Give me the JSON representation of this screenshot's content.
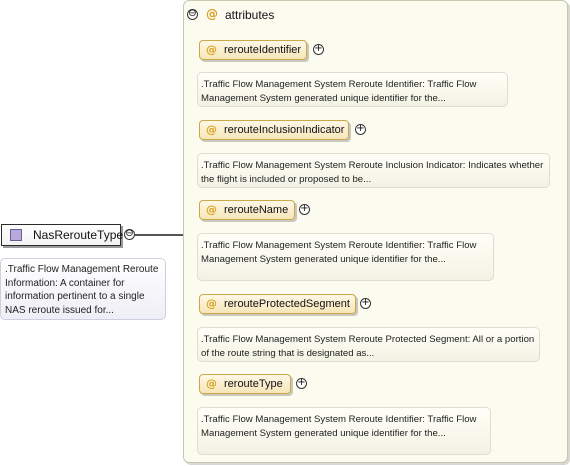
{
  "element": {
    "name": "NasRerouteType",
    "icon": "complex-type-icon",
    "expander": "⊖",
    "documentation": ".Traffic Flow Management Reroute Information: A container for information pertinent to a single NAS reroute issued for..."
  },
  "attributes_group": {
    "title": "attributes",
    "expander": "⊖",
    "at_symbol": "@",
    "items": [
      {
        "name": "rerouteIdentifier",
        "expander": "+",
        "documentation": ".Traffic Flow Management System Reroute Identifier: Traffic Flow Management System generated unique identifier for the..."
      },
      {
        "name": "rerouteInclusionIndicator",
        "expander": "+",
        "documentation": ".Traffic Flow Management System Reroute Inclusion Indicator: Indicates whether the flight is included or proposed to be..."
      },
      {
        "name": "rerouteName",
        "expander": "+",
        "documentation": ".Traffic Flow Management System Reroute Identifier: Traffic Flow Management System generated unique identifier for the..."
      },
      {
        "name": "rerouteProtectedSegment",
        "expander": "+",
        "documentation": ".Traffic Flow Management System Reroute Protected Segment: All or a portion of the route string that is designated as..."
      },
      {
        "name": "rerouteType",
        "expander": "+",
        "documentation": ".Traffic Flow Management System Reroute Identifier: Traffic Flow Management System generated unique identifier for the..."
      }
    ]
  },
  "colors": {
    "attribute_fill": "#f6e6b8",
    "attribute_border": "#c9a848",
    "at_symbol": "#d9a020",
    "group_fill": "#fbfbf0",
    "type_icon": "#b8a9db"
  }
}
